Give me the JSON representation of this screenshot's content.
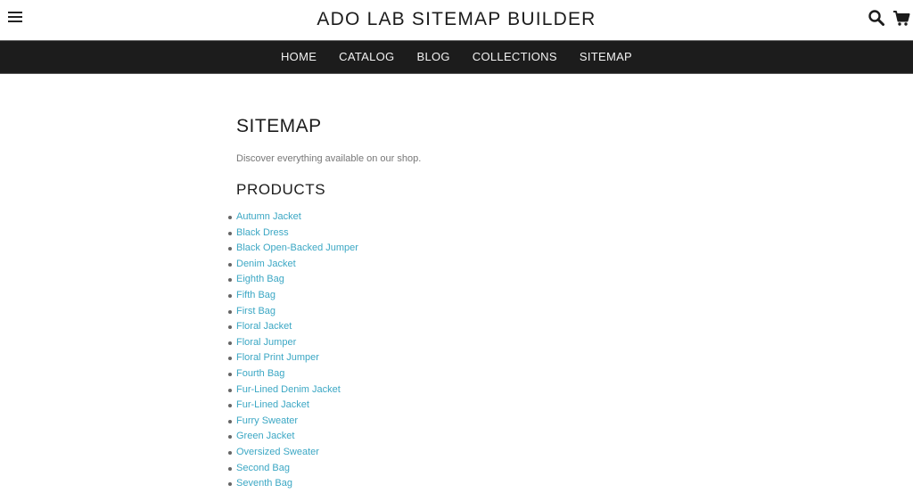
{
  "header": {
    "title": "ADO LAB SITEMAP BUILDER",
    "menu_icon": "hamburger-menu-icon",
    "search_icon": "search-icon",
    "cart_icon": "cart-icon"
  },
  "nav": {
    "items": [
      {
        "label": "HOME"
      },
      {
        "label": "CATALOG"
      },
      {
        "label": "BLOG"
      },
      {
        "label": "COLLECTIONS"
      },
      {
        "label": "SITEMAP"
      }
    ]
  },
  "main": {
    "title": "SITEMAP",
    "description": "Discover everything available on our shop.",
    "products_heading": "PRODUCTS",
    "products": [
      "Autumn Jacket",
      "Black Dress",
      "Black Open-Backed Jumper",
      "Denim Jacket",
      "Eighth Bag",
      "Fifth Bag",
      "First Bag",
      "Floral Jacket",
      "Floral Jumper",
      "Floral Print Jumper",
      "Fourth Bag",
      "Fur-Lined Denim Jacket",
      "Fur-Lined Jacket",
      "Furry Sweater",
      "Green Jacket",
      "Oversized Sweater",
      "Second Bag",
      "Seventh Bag"
    ]
  },
  "colors": {
    "nav_background": "#1c1c1c",
    "link": "#3ba7c4",
    "text": "#1c1c1c"
  }
}
